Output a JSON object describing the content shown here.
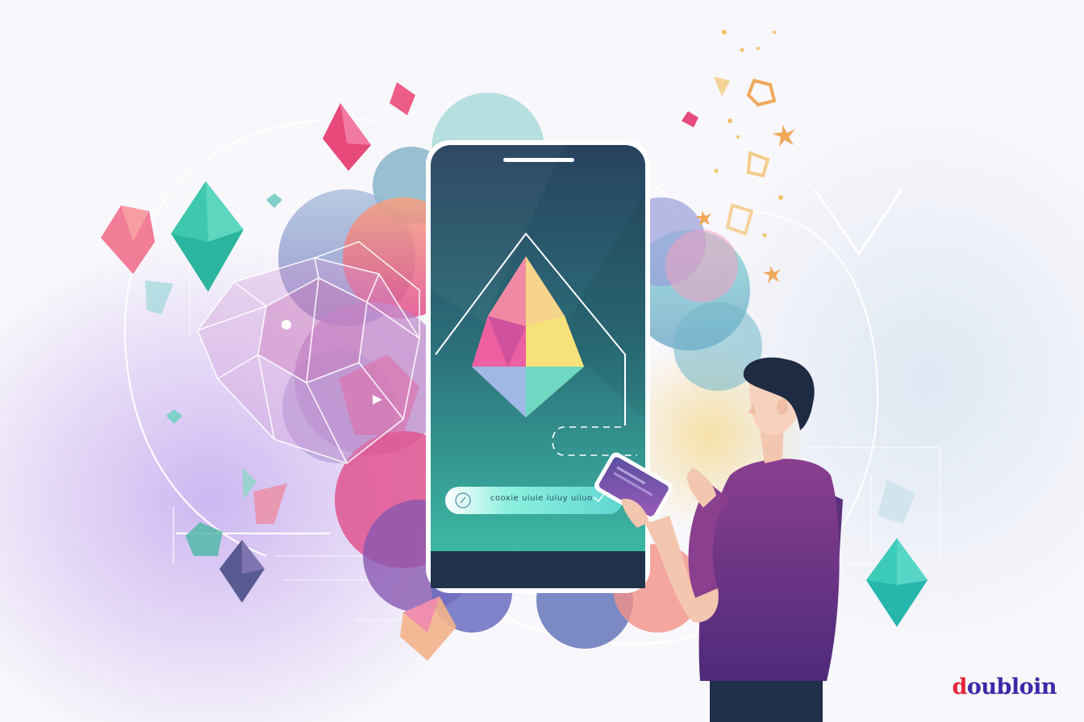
{
  "phone": {
    "action_bar_text": "cooxie uiuie iuiuy uiiuo"
  },
  "brand": {
    "mark": "d",
    "rest": "oubloin"
  },
  "palette": {
    "teal": "#3cc9b4",
    "pink": "#ef5b8c",
    "purple": "#7d4aa8",
    "navy": "#20334b",
    "gold": "#f1c46b",
    "brand_red": "#e2273b",
    "brand_blue": "#3a2aa8"
  }
}
